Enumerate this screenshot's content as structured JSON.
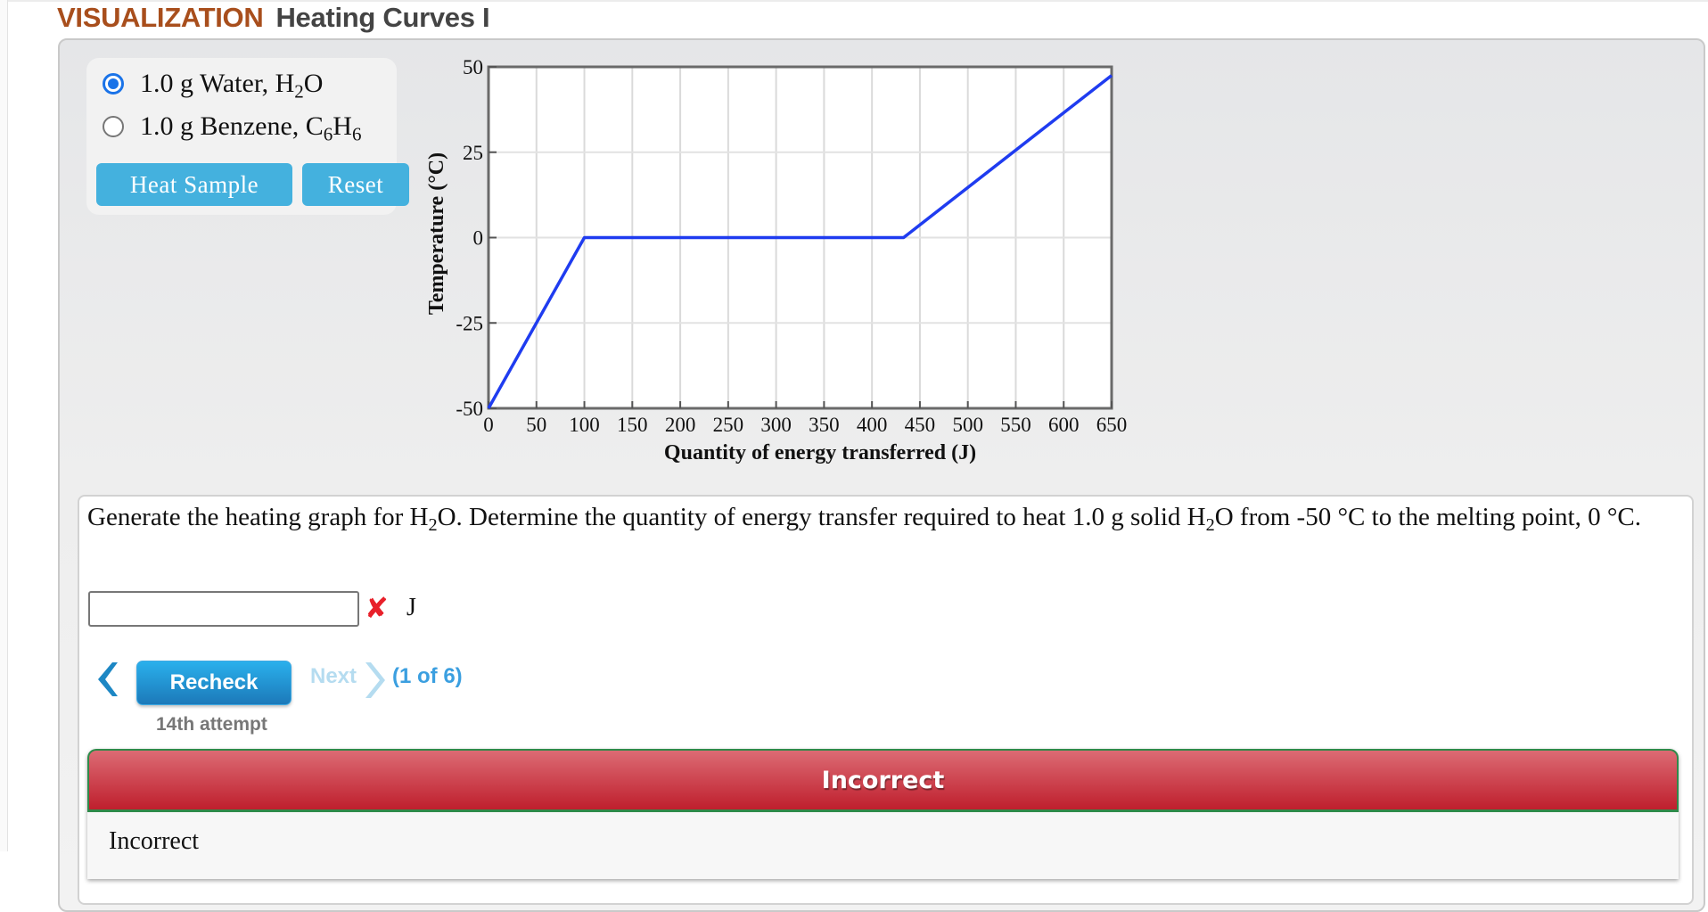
{
  "header": {
    "section_label": "VISUALIZATION",
    "title": "Heating Curves I"
  },
  "controls": {
    "options": [
      {
        "label_prefix": "1.0 g Water, H",
        "sub1": "2",
        "label_mid": "O",
        "sub2": "",
        "selected": true
      },
      {
        "label_prefix": "1.0 g Benzene, C",
        "sub1": "6",
        "label_mid": "H",
        "sub2": "6",
        "selected": false
      }
    ],
    "heat_button": "Heat Sample",
    "reset_button": "Reset"
  },
  "chart_data": {
    "type": "line",
    "title": "",
    "xlabel": "Quantity of energy transferred (J)",
    "ylabel": "Temperature (°C)",
    "xlim": [
      0,
      650
    ],
    "ylim": [
      -50,
      50
    ],
    "xticks": [
      "0",
      "50",
      "100",
      "150",
      "200",
      "250",
      "300",
      "350",
      "400",
      "450",
      "500",
      "550",
      "600",
      "650"
    ],
    "yticks": [
      "-50",
      "-25",
      "0",
      "25",
      "50"
    ],
    "grid": true,
    "series": [
      {
        "name": "1.0 g Water, H2O",
        "color": "#1f3cf0",
        "x": [
          0,
          100,
          433,
          650
        ],
        "y": [
          -50,
          0,
          0,
          47.5
        ]
      }
    ]
  },
  "question": {
    "text_part1": "Generate the heating graph for H",
    "sub_a": "2",
    "text_part2": "O. Determine the quantity of energy transfer required to heat 1.0 g solid H",
    "sub_b": "2",
    "text_part3": "O from -50 °C to the melting point, 0 °C.",
    "answer_value": "",
    "status_icon": "incorrect-x-icon",
    "unit": "J"
  },
  "navigation": {
    "recheck_button": "Recheck",
    "next_label": "Next",
    "counter": "(1 of 6)",
    "attempt": "14th attempt"
  },
  "feedback": {
    "header": "Incorrect",
    "body": "Incorrect",
    "header_color": "#c8303c"
  }
}
